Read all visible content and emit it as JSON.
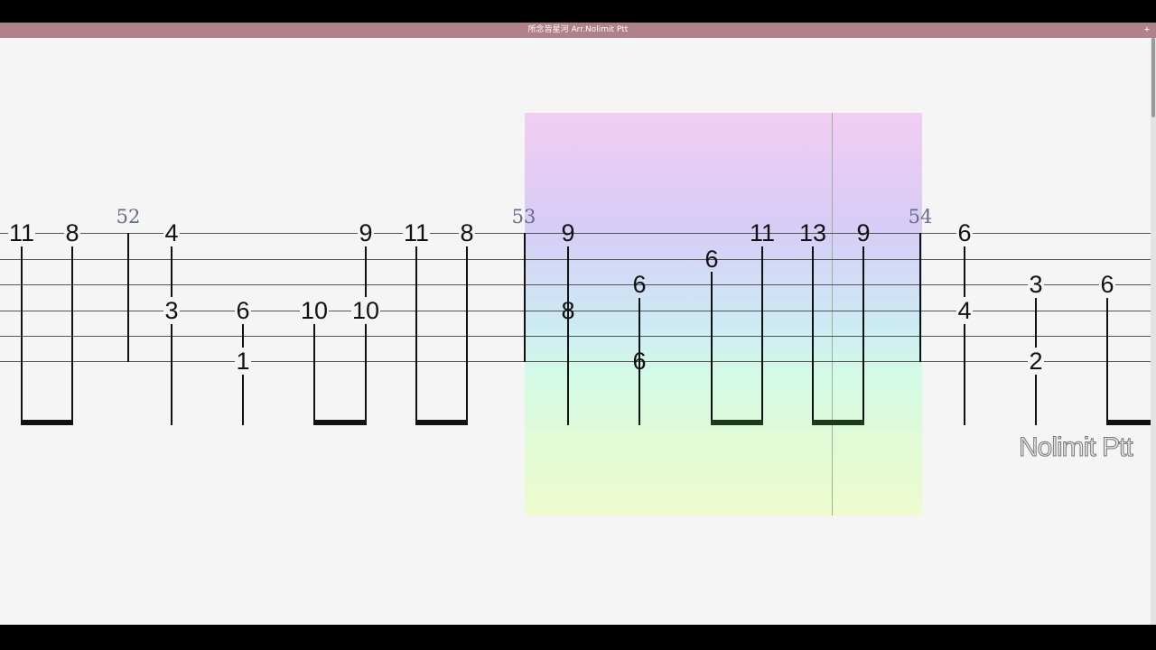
{
  "window": {
    "title": "所念皆星河 Arr.Nolimit Ptt",
    "add_button": "+"
  },
  "colors": {
    "titlebar": "#b0808b",
    "page": "#f5f5f5",
    "highlight_top": "#f2cdf2",
    "highlight_bottom": "#eefbcf"
  },
  "measures": [
    {
      "number": "52"
    },
    {
      "number": "53"
    },
    {
      "number": "54"
    }
  ],
  "watermark": "Nolimit Ptt",
  "notes": [
    {
      "fret": "11",
      "string": 1
    },
    {
      "fret": "8",
      "string": 1
    },
    {
      "fret": "4",
      "string": 1
    },
    {
      "fret": "3",
      "string": 4
    },
    {
      "fret": "6",
      "string": 4
    },
    {
      "fret": "1",
      "string": 6
    },
    {
      "fret": "10",
      "string": 4
    },
    {
      "fret": "9",
      "string": 1
    },
    {
      "fret": "10",
      "string": 4
    },
    {
      "fret": "11",
      "string": 1
    },
    {
      "fret": "8",
      "string": 1
    },
    {
      "fret": "9",
      "string": 1
    },
    {
      "fret": "8",
      "string": 4
    },
    {
      "fret": "6",
      "string": 3
    },
    {
      "fret": "6",
      "string": 6
    },
    {
      "fret": "6",
      "string": 2
    },
    {
      "fret": "11",
      "string": 1
    },
    {
      "fret": "13",
      "string": 1
    },
    {
      "fret": "9",
      "string": 1
    },
    {
      "fret": "6",
      "string": 1
    },
    {
      "fret": "4",
      "string": 4
    },
    {
      "fret": "3",
      "string": 3
    },
    {
      "fret": "2",
      "string": 6
    },
    {
      "fret": "6",
      "string": 3
    }
  ]
}
